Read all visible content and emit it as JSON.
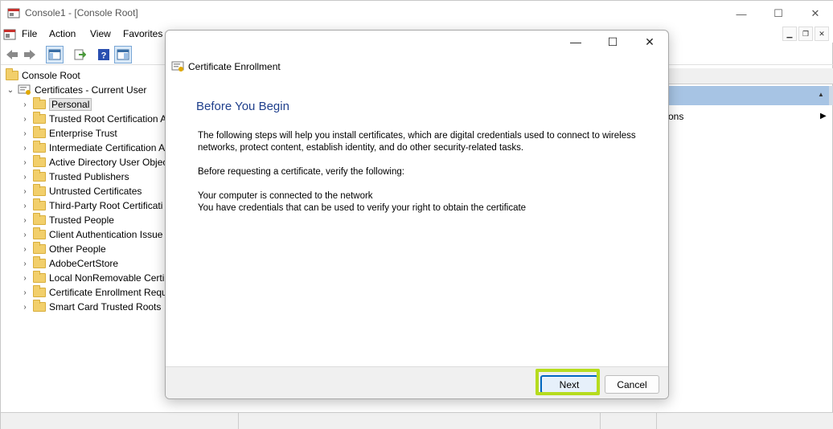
{
  "window": {
    "title": "Console1 - [Console Root]",
    "minimize": "—",
    "maximize": "☐",
    "close": "✕"
  },
  "menu": {
    "items": [
      "File",
      "Action",
      "View",
      "Favorites"
    ]
  },
  "tree": {
    "root": "Console Root",
    "store": "Certificates - Current User",
    "folders": [
      "Personal",
      "Trusted Root Certification A",
      "Enterprise Trust",
      "Intermediate Certification A",
      "Active Directory User Objec",
      "Trusted Publishers",
      "Untrusted Certificates",
      "Third-Party Root Certificati",
      "Trusted People",
      "Client Authentication Issue",
      "Other People",
      "AdobeCertStore",
      "Local NonRemovable Certi",
      "Certificate Enrollment Requ",
      "Smart Card Trusted Roots"
    ]
  },
  "right_pane": {
    "more_actions": "ons"
  },
  "dialog": {
    "title": "Certificate Enrollment",
    "heading": "Before You Begin",
    "para1": "The following steps will help you install certificates, which are digital credentials used to connect to wireless networks, protect content, establish identity, and do other security-related tasks.",
    "para2": "Before requesting a certificate, verify the following:",
    "req1": "Your computer is connected to the network",
    "req2": "You have credentials that can be used to verify your right to obtain the certificate",
    "next": "Next",
    "cancel": "Cancel"
  },
  "colors": {
    "heading": "#1f3f8c",
    "highlight": "#b6dc1e",
    "actions_bar": "#a7c4e4"
  }
}
